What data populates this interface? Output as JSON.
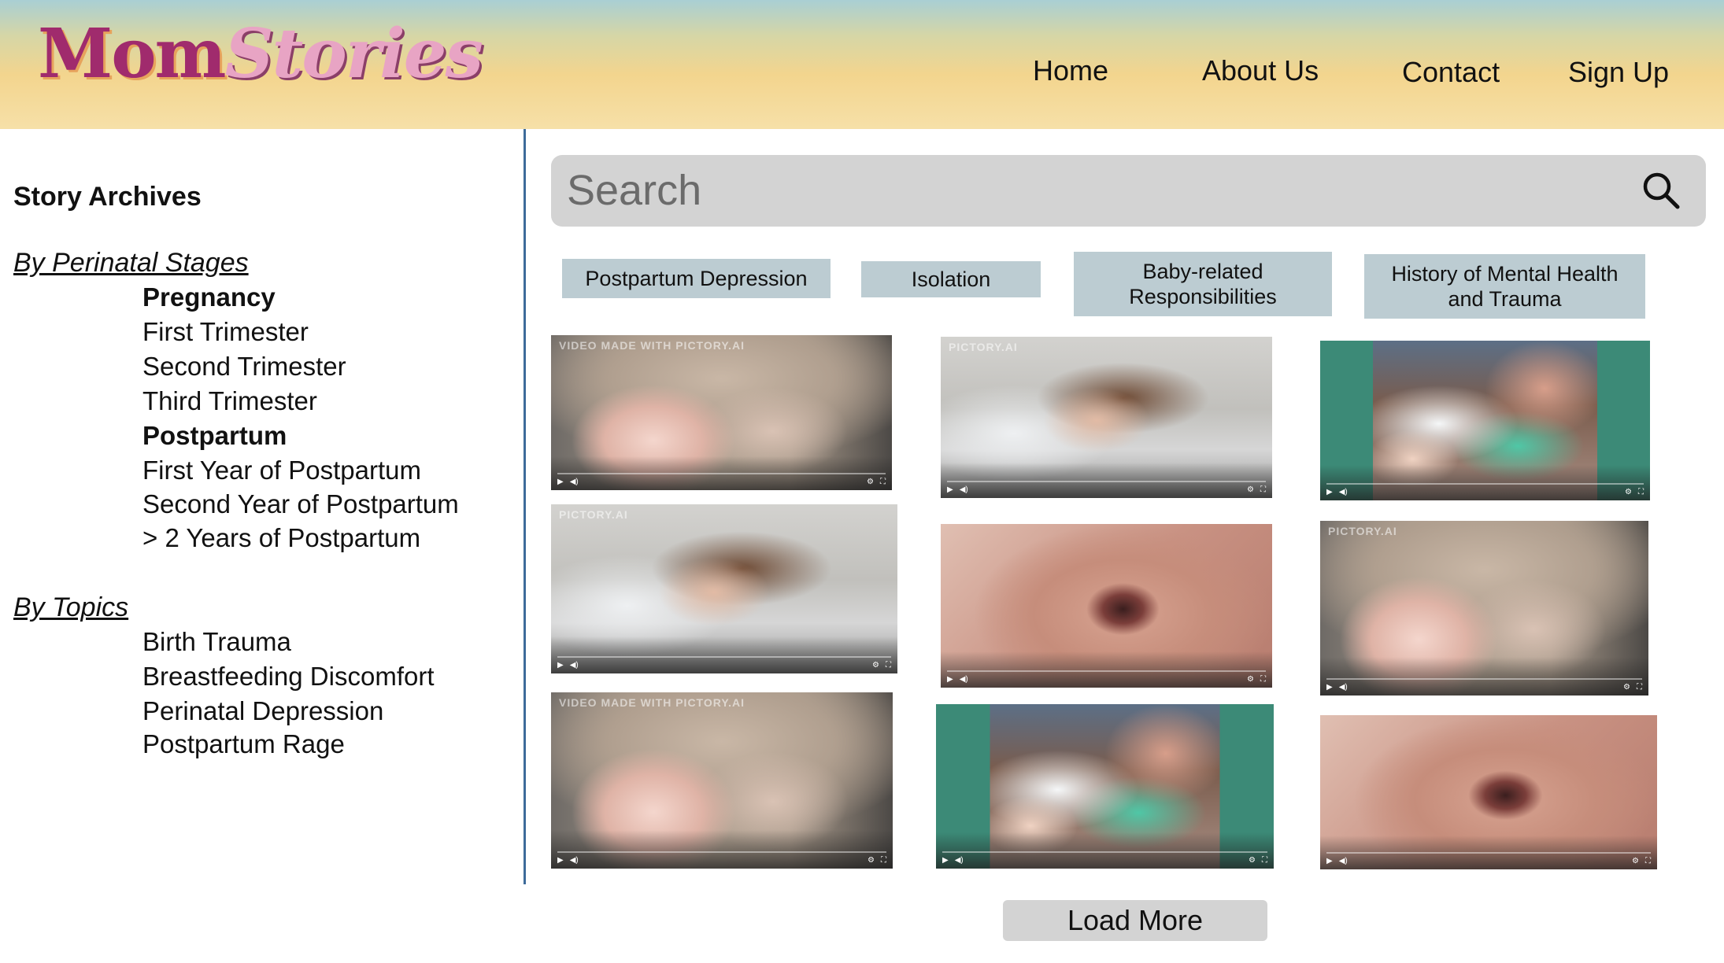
{
  "header": {
    "logo": {
      "part1": "Mom",
      "part2": "Stories"
    },
    "nav": [
      {
        "label": "Home"
      },
      {
        "label": "About Us"
      },
      {
        "label": "Contact"
      },
      {
        "label": "Sign Up"
      }
    ]
  },
  "sidebar": {
    "title": "Story Archives",
    "sections": [
      {
        "heading": "By Perinatal Stages",
        "items": [
          {
            "label": "Pregnancy",
            "bold": true
          },
          {
            "label": "First Trimester"
          },
          {
            "label": "Second Trimester"
          },
          {
            "label": "Third Trimester"
          },
          {
            "label": "Postpartum",
            "bold": true
          },
          {
            "label": "First Year of Postpartum"
          },
          {
            "label": "Second Year of Postpartum"
          },
          {
            "label": "> 2 Years of Postpartum"
          }
        ]
      },
      {
        "heading": "By Topics",
        "items": [
          {
            "label": "Birth Trauma"
          },
          {
            "label": "Breastfeeding Discomfort"
          },
          {
            "label": "Perinatal Depression"
          },
          {
            "label": "Postpartum Rage"
          }
        ]
      }
    ]
  },
  "search": {
    "placeholder": "Search",
    "icon": "search-icon"
  },
  "filters": [
    {
      "label": "Postpartum Depression"
    },
    {
      "label": "Isolation"
    },
    {
      "label": "Baby-related Responsibilities"
    },
    {
      "label": "History of Mental Health and Trauma"
    }
  ],
  "videos": [
    {
      "scene": "mother-holding-baby",
      "watermark": "VIDEO MADE WITH PICTORY.AI"
    },
    {
      "scene": "woman-lying-in-bed",
      "watermark": "PICTORY.AI"
    },
    {
      "scene": "mother-with-newborn-hospital"
    },
    {
      "scene": "woman-lying-in-bed",
      "watermark": "PICTORY.AI"
    },
    {
      "scene": "crying-newborn"
    },
    {
      "scene": "mother-holding-baby",
      "watermark": "PICTORY.AI"
    },
    {
      "scene": "mother-holding-baby",
      "watermark": "VIDEO MADE WITH PICTORY.AI"
    },
    {
      "scene": "mother-with-newborn-hospital"
    },
    {
      "scene": "crying-newborn"
    }
  ],
  "load_more_label": "Load More",
  "colors": {
    "sidebar_divider": "#3d6b9a",
    "chip_background": "#bcccd2",
    "search_background": "#d3d3d3",
    "logo_primary": "#a02b6d",
    "logo_secondary": "#e8a4c4"
  }
}
